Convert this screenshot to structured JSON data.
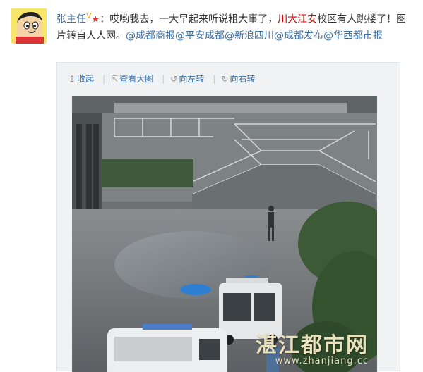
{
  "post": {
    "author": "张主任",
    "vip_mark": "V",
    "star_mark": "★",
    "separator": "：",
    "text_part1": "哎哟我去，一大早起来听说粗大事了，",
    "highlight": "川大江安",
    "text_part2": "校区有人跳楼了！图片转自人人网。",
    "mentions": [
      "@成都商报",
      "@平安成都",
      "@新浪四川",
      "@成都发布",
      "@华西都市报"
    ]
  },
  "toolbar": {
    "collapse": "收起",
    "view_large": "查看大图",
    "rotate_left": "向左转",
    "rotate_right": "向右转"
  },
  "watermark": {
    "text": "湛江都市网",
    "url": "www.zhanjiang.cc"
  },
  "colors": {
    "link": "#3a6ea5",
    "highlight": "#cc0000",
    "body_text": "#333333"
  }
}
